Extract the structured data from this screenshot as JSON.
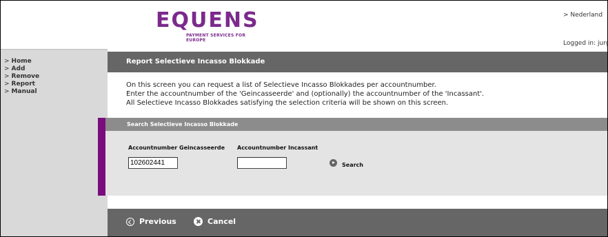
{
  "header": {
    "logo_text": "EQUENS",
    "logo_tagline": "PAYMENT SERVICES FOR EUROPE",
    "country_link": "> Nederland",
    "logged_in": "Logged in: jurg"
  },
  "sidebar": {
    "items": [
      {
        "label": "Home"
      },
      {
        "label": "Add"
      },
      {
        "label": "Remove"
      },
      {
        "label": "Report"
      },
      {
        "label": "Manual"
      }
    ]
  },
  "main": {
    "title": "Report Selectieve Incasso Blokkade",
    "description": [
      "On this screen you can request a list of Selectieve Incasso Blokkades per accountnumber.",
      "Enter the accountnumber of the 'Geincasseerde' and (optionally) the accountnumber of the 'Incassant'.",
      "All Selectieve Incasso Blokkades satisfying the selection criteria will be shown on this screen."
    ]
  },
  "search": {
    "heading": "Search Selectieve Incasso Blokkade",
    "geincasseerde_label": "Accountnumber Geincasseerde",
    "geincasseerde_value": "102602441",
    "incassant_label": "Accountnumber Incassant",
    "incassant_value": "",
    "button_label": "Search"
  },
  "footer": {
    "previous_label": "Previous",
    "cancel_label": "Cancel"
  },
  "colors": {
    "brand_purple": "#7b2a8c",
    "accent_bar": "#7b0c7e",
    "title_bar": "#666666",
    "sidebar_bg": "#d9d9d9",
    "panel_bg": "#e4e4e4"
  }
}
